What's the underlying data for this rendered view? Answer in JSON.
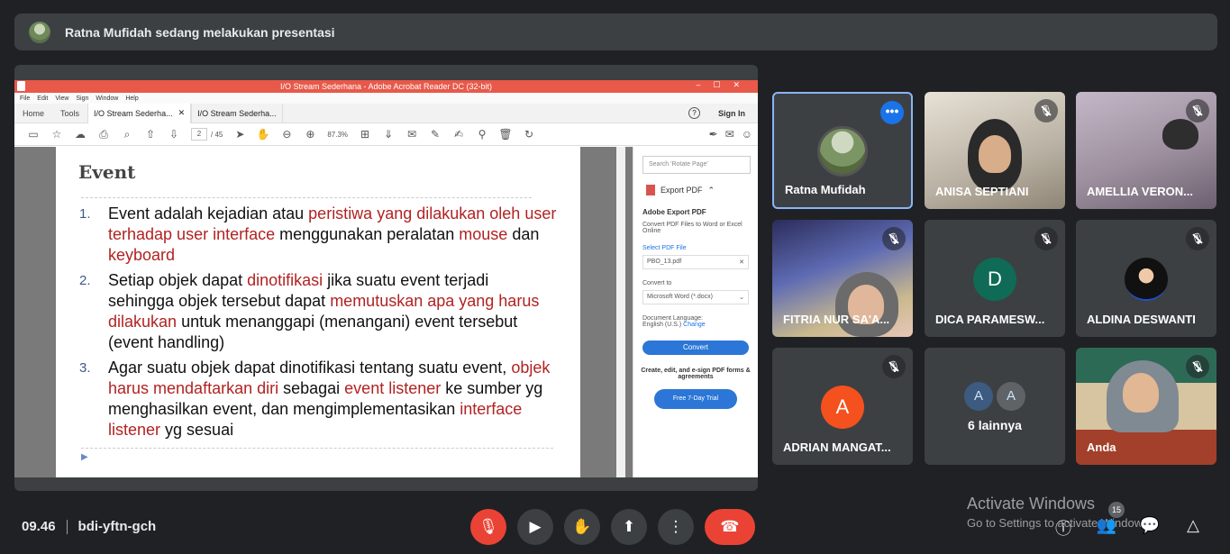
{
  "banner": {
    "text": "Ratna Mufidah sedang melakukan presentasi"
  },
  "acrobat": {
    "title": "I/O Stream Sederhana - Adobe Acrobat Reader DC (32-bit)",
    "window_controls": "–☐✕",
    "menu": [
      "File",
      "Edit",
      "View",
      "Sign",
      "Window",
      "Help"
    ],
    "nav": {
      "home": "Home",
      "tools": "Tools"
    },
    "tabs": [
      {
        "label": "I/O Stream Sederha...",
        "close": "✕"
      },
      {
        "label": "I/O Stream Sederha..."
      }
    ],
    "help": "?",
    "sign_in": "Sign In",
    "page_current": "2",
    "page_total": "/ 45",
    "zoom": "87.3%"
  },
  "slide": {
    "title": "Event",
    "items": [
      {
        "num": "1.",
        "parts": [
          {
            "t": "Event adalah kejadian atau ",
            "red": false
          },
          {
            "t": "peristiwa yang dilakukan oleh user terhadap user interface",
            "red": true
          },
          {
            "t": " menggunakan peralatan ",
            "red": false
          },
          {
            "t": "mouse",
            "red": true
          },
          {
            "t": " dan ",
            "red": false
          },
          {
            "t": "keyboard",
            "red": true
          }
        ]
      },
      {
        "num": "2.",
        "parts": [
          {
            "t": "Setiap objek dapat ",
            "red": false
          },
          {
            "t": "dinotifikasi",
            "red": true
          },
          {
            "t": " jika suatu event terjadi sehingga objek tersebut dapat ",
            "red": false
          },
          {
            "t": "memutuskan apa yang harus dilakukan",
            "red": true
          },
          {
            "t": " untuk menanggapi (menangani) event tersebut (event handling)",
            "red": false
          }
        ]
      },
      {
        "num": "3.",
        "parts": [
          {
            "t": "Agar suatu objek dapat dinotifikasi tentang suatu event, ",
            "red": false
          },
          {
            "t": "objek harus mendaftarkan diri",
            "red": true
          },
          {
            "t": " sebagai ",
            "red": false
          },
          {
            "t": "event listener",
            "red": true
          },
          {
            "t": " ke sumber yg menghasilkan event, dan mengimplementasikan ",
            "red": false
          },
          {
            "t": "interface listener",
            "red": true
          },
          {
            "t": " yg sesuai",
            "red": false
          }
        ]
      }
    ]
  },
  "sidepane": {
    "search_placeholder": "Search 'Rotate Page'",
    "export_title": "Export PDF",
    "adobe_export": "Adobe Export PDF",
    "convert_desc": "Convert PDF Files to Word or Excel Online",
    "select_pdf": "Select PDF File",
    "file": "PBO_13.pdf",
    "convert_to": "Convert to",
    "format": "Microsoft Word (*.docx)",
    "doc_lang": "Document Language:",
    "lang": "English (U.S.)",
    "change": "Change",
    "convert_btn": "Convert",
    "promo": "Create, edit, and e-sign PDF forms & agreements",
    "trial": "Free 7-Day Trial"
  },
  "participants": [
    {
      "name": "Ratna Mufidah"
    },
    {
      "name": "ANISA SEPTIANI"
    },
    {
      "name": "AMELLIA VERON..."
    },
    {
      "name": "FITRIA NUR SA'A..."
    },
    {
      "name": "DICA PARAMESW...",
      "letter": "D",
      "color": "#0f6b55"
    },
    {
      "name": "ALDINA DESWANTI"
    },
    {
      "name": "ADRIAN MANGAT...",
      "letter": "A",
      "color": "#f4511e"
    },
    {
      "name": "6 lainnya",
      "avatars": [
        "A",
        "A"
      ]
    },
    {
      "name": "Anda"
    }
  ],
  "meeting": {
    "time": "09.46",
    "code": "bdi-yftn-gch"
  },
  "watermark": {
    "line1": "Activate Windows",
    "line2": "Go to Settings to activate Windows."
  },
  "people_count": "15",
  "colors": {
    "accent": "#8ab4f8",
    "danger": "#ea4335",
    "bg": "#202124",
    "tile": "#3c4043"
  }
}
